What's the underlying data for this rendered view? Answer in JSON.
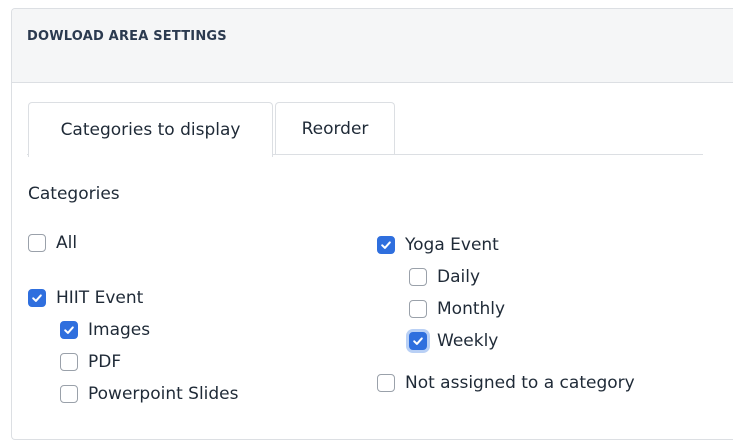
{
  "panel": {
    "title": "DOWLOAD AREA SETTINGS"
  },
  "tabs": [
    {
      "label": "Categories to display",
      "active": true
    },
    {
      "label": "Reorder",
      "active": false
    }
  ],
  "section": {
    "label": "Categories"
  },
  "left_column": {
    "all": {
      "label": "All",
      "checked": false
    },
    "hiit": {
      "label": "HIIT Event",
      "checked": true
    },
    "hiit_children": [
      {
        "label": "Images",
        "checked": true
      },
      {
        "label": "PDF",
        "checked": false
      },
      {
        "label": "Powerpoint Slides",
        "checked": false
      }
    ]
  },
  "right_column": {
    "yoga": {
      "label": "Yoga Event",
      "checked": true
    },
    "yoga_children": [
      {
        "label": "Daily",
        "checked": false
      },
      {
        "label": "Monthly",
        "checked": false
      },
      {
        "label": "Weekly",
        "checked": true,
        "focused": true
      }
    ],
    "unassigned": {
      "label": "Not assigned to a category",
      "checked": false
    }
  },
  "colors": {
    "accent": "#2f6fde",
    "border": "#dcdfe3",
    "header_bg": "#f5f6f7"
  },
  "icons": {
    "check": "checkmark-icon"
  }
}
